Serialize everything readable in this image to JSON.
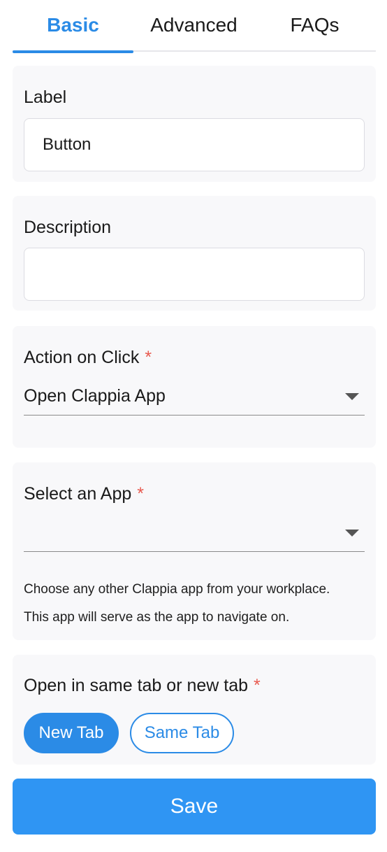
{
  "tabs": [
    {
      "label": "Basic",
      "active": true
    },
    {
      "label": "Advanced",
      "active": false
    },
    {
      "label": "FAQs",
      "active": false
    }
  ],
  "label_section": {
    "title": "Label",
    "value": "Button"
  },
  "description_section": {
    "title": "Description",
    "value": ""
  },
  "action_section": {
    "title": "Action on Click",
    "required": "*",
    "selected": "Open Clappia App",
    "icon": "chevron-down-icon"
  },
  "app_section": {
    "title": "Select an App",
    "required": "*",
    "selected": "",
    "icon": "chevron-down-icon",
    "helper_line1": "Choose any other Clappia app from your workplace.",
    "helper_line2": "This app will serve as the app to navigate on."
  },
  "tab_section": {
    "title": "Open in same tab or new tab",
    "required": "*",
    "options": [
      {
        "label": "New Tab",
        "selected": true
      },
      {
        "label": "Same Tab",
        "selected": false
      }
    ]
  },
  "save_label": "Save",
  "colors": {
    "accent": "#2b8be6",
    "required": "#e85a4f",
    "card_bg": "#f8f8fa"
  }
}
